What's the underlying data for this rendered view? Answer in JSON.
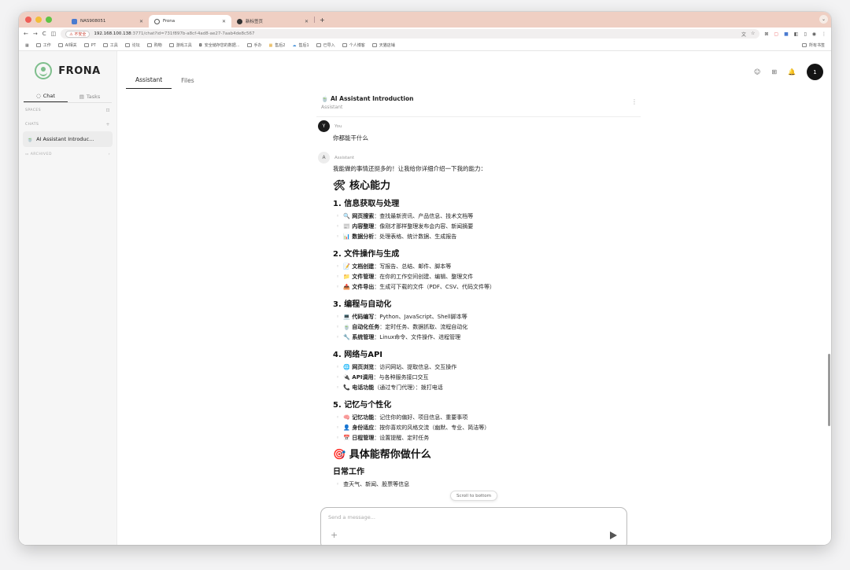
{
  "browser": {
    "tabs": [
      {
        "title": "NAS908051",
        "favicon_color": "#4a7bd0"
      },
      {
        "title": "Frona",
        "favicon_color": "#555555"
      },
      {
        "title": "新标签页",
        "favicon_color": "#333333"
      }
    ],
    "insecure_label": "不安全",
    "url_host": "192.168.100.138",
    "url_rest": ":3771/chat?id=731f897b-a8cf-4ad8-ae27-7aab4de8c567",
    "bookmarks": [
      "工作",
      "AI相关",
      "PT",
      "工具",
      "论坛",
      "购物",
      "游戏工具",
      "安全储存您的数据...",
      "手办",
      "售后2",
      "售后1",
      "已导入",
      "个人博客",
      "天猫店铺"
    ],
    "bookmarks_right": "所有书签"
  },
  "app": {
    "logo": "FRONA",
    "tabs": {
      "chat": "Chat",
      "tasks": "Tasks"
    },
    "sections": {
      "spaces": "SPACES",
      "chats": "CHATS",
      "archived": "ARCHIVED"
    },
    "chats": [
      "AI Assistant Introduc..."
    ],
    "main_tabs": [
      "Assistant",
      "Files"
    ],
    "user_avatar": "1"
  },
  "chat": {
    "title": "🍵 AI Assistant Introduction",
    "subtitle": "Assistant",
    "user_avatar": "Y",
    "user_name": "You",
    "user_message": "你都能干什么",
    "assistant_avatar": "A",
    "assistant_name": "Assistant",
    "intro": "我能做的事情还挺多的！让我给你详细介绍一下我的能力：",
    "core_heading": "🛠 核心能力",
    "sections": [
      {
        "title": "1. 信息获取与处理",
        "items": [
          {
            "label": "🔍 网页搜索",
            "desc": "：查找最新资讯、产品信息、技术文档等"
          },
          {
            "label": "📰 内容整理",
            "desc": "：像刚才那样整理发布会内容、新闻摘要"
          },
          {
            "label": "📊 数据分析",
            "desc": "：处理表格、统计数据、生成报告"
          }
        ]
      },
      {
        "title": "2. 文件操作与生成",
        "items": [
          {
            "label": "📝 文档创建",
            "desc": "：写报告、总结、邮件、脚本等"
          },
          {
            "label": "📁 文件管理",
            "desc": "：在你的工作空间创建、编辑、整理文件"
          },
          {
            "label": "📤 文件导出",
            "desc": "：生成可下载的文件（PDF、CSV、代码文件等）"
          }
        ]
      },
      {
        "title": "3. 编程与自动化",
        "items": [
          {
            "label": "💻 代码编写",
            "desc": "：Python、JavaScript、Shell脚本等"
          },
          {
            "label": "🍵 自动化任务",
            "desc": "：定时任务、数据抓取、流程自动化"
          },
          {
            "label": "🔧 系统管理",
            "desc": "：Linux命令、文件操作、进程管理"
          }
        ]
      },
      {
        "title": "4. 网络与API",
        "items": [
          {
            "label": "🌐 网页浏览",
            "desc": "：访问网站、提取信息、交互操作"
          },
          {
            "label": "🔌 API调用",
            "desc": "：与各种服务接口交互"
          },
          {
            "label": "📞 电话功能",
            "desc": "（通过专门代理）：拨打电话"
          }
        ]
      },
      {
        "title": "5. 记忆与个性化",
        "items": [
          {
            "label": "🧠 记忆功能",
            "desc": "：记住你的偏好、项目信息、重要事项"
          },
          {
            "label": "👤 身份适应",
            "desc": "：按你喜欢的风格交流（幽默、专业、简洁等）"
          },
          {
            "label": "📅 日程管理",
            "desc": "：设置提醒、定时任务"
          }
        ]
      }
    ],
    "help_heading": "🎯 具体能帮你做什么",
    "daily_heading": "日常工作",
    "daily_items": [
      "查天气、新闻、股票等信息"
    ],
    "scroll_bottom": "Scroll to bottom",
    "composer_placeholder": "Send a message..."
  }
}
